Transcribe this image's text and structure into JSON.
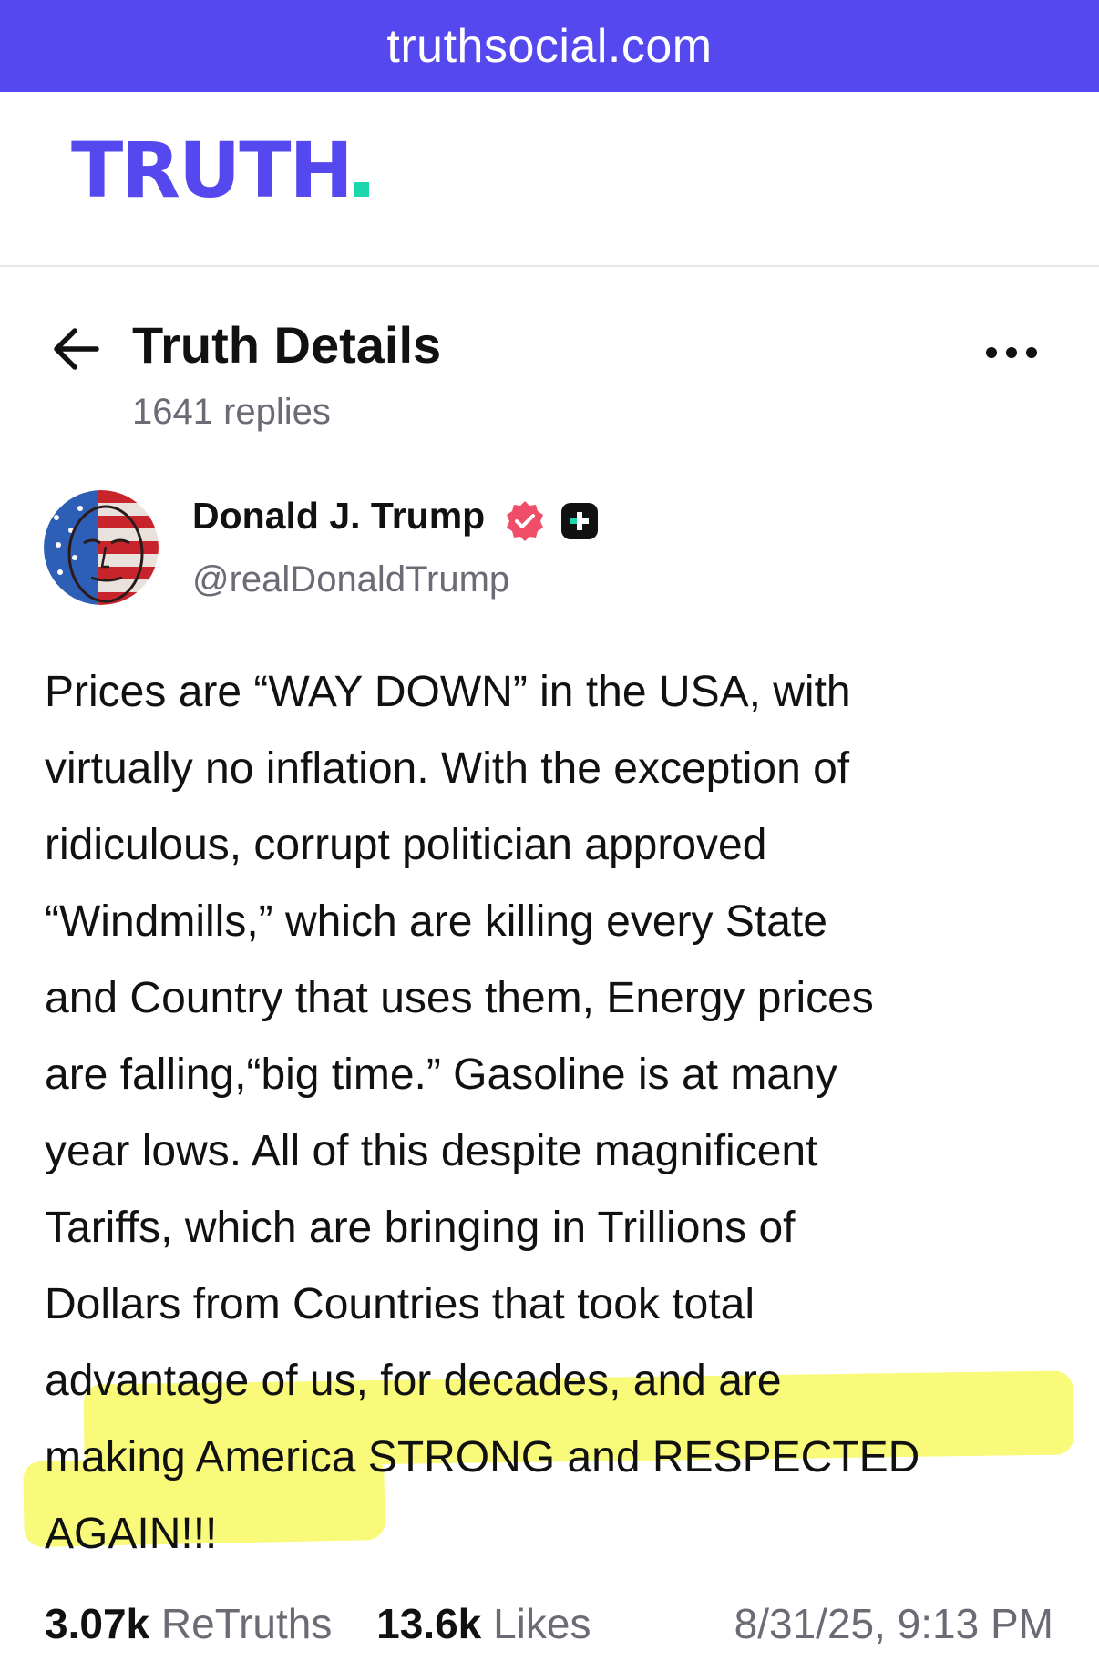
{
  "browser": {
    "url": "truthsocial.com"
  },
  "header": {
    "logo_text": "TRUTH"
  },
  "page": {
    "title": "Truth Details",
    "replies": "1641 replies"
  },
  "author": {
    "name": "Donald J. Trump",
    "handle": "@realDonaldTrump",
    "badges": [
      "verified-badge-icon",
      "plus-badge-icon"
    ]
  },
  "post": {
    "lines": [
      "Prices are “WAY DOWN” in the USA, with",
      "virtually no inflation. With the exception of",
      "ridiculous, corrupt politician approved",
      "“Windmills,” which are killing every State",
      "and Country that uses them, Energy prices",
      "are falling,“big time.” Gasoline is at many",
      "year lows. All of this despite magnificent",
      "Tariffs, which are bringing in Trillions of",
      "Dollars from Countries that took total",
      "advantage of us, for decades, and are",
      "making America STRONG and RESPECTED",
      "AGAIN!!!"
    ],
    "highlight_color": "#f9f97a"
  },
  "stats": {
    "retruths_count": "3.07k",
    "retruths_label": "ReTruths",
    "likes_count": "13.6k",
    "likes_label": "Likes",
    "timestamp": "8/31/25, 9:13 PM"
  },
  "colors": {
    "brand": "#5448ee",
    "brand_accent": "#1cd6ae",
    "verified": "#f04d6a",
    "muted_text": "#6b6b76"
  }
}
